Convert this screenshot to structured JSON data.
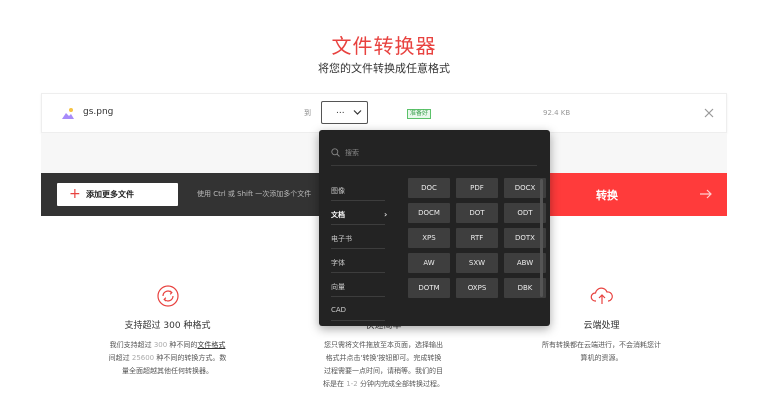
{
  "header": {
    "title": "文件转换器",
    "subtitle": "将您的文件转换成任意格式"
  },
  "file": {
    "name": "gs.png",
    "to_label": "到",
    "format_value": "...",
    "status_badge": "准备好",
    "size": "92.4 KB"
  },
  "action_bar": {
    "add_button_label": "添加更多文件",
    "hint": "使用 Ctrl 或 Shift 一次添加多个文件",
    "convert_label": "转换"
  },
  "dropdown": {
    "search_placeholder": "搜索",
    "categories": [
      {
        "label": "图像",
        "active": false
      },
      {
        "label": "文档",
        "active": true
      },
      {
        "label": "电子书",
        "active": false
      },
      {
        "label": "字体",
        "active": false
      },
      {
        "label": "向量",
        "active": false
      },
      {
        "label": "CAD",
        "active": false
      }
    ],
    "options": [
      "DOC",
      "PDF",
      "DOCX",
      "DOCM",
      "DOT",
      "ODT",
      "XPS",
      "RTF",
      "DOTX",
      "AW",
      "SXW",
      "ABW",
      "DOTM",
      "OXPS",
      "DBK"
    ]
  },
  "features": [
    {
      "icon": "refresh-circle-icon",
      "title": "支持超过 300 种格式",
      "desc_1a": "我们支持超过 ",
      "desc_1b": "300",
      "desc_1c": " 种不同的",
      "desc_1d": "文件格式",
      "desc_2a": "间超过 ",
      "desc_2b": "25600",
      "desc_2c": " 种不同的转换方式。数",
      "desc_3": "量全面超越其他任何转换器。"
    },
    {
      "title": "快速简单",
      "desc_1": "您只需将文件拖放至本页面，选择输出",
      "desc_2": "格式并点击'转换'按钮即可。完成转换",
      "desc_3": "过程需要一点时间，请稍等。我们的目",
      "desc_4a": "标是在 ",
      "desc_4b": "1-2",
      "desc_4c": " 分钟内完成全部转换过程。"
    },
    {
      "icon": "cloud-upload-icon",
      "title": "云端处理",
      "desc_1": "所有转换都在云端进行，不会消耗您计",
      "desc_2": "算机的资源。"
    }
  ],
  "colors": {
    "accent": "#e8423f",
    "convert_button": "#ff3b3b",
    "dark_bar": "#333333",
    "dropdown_bg": "#232323",
    "badge_green": "#3aa04d"
  }
}
